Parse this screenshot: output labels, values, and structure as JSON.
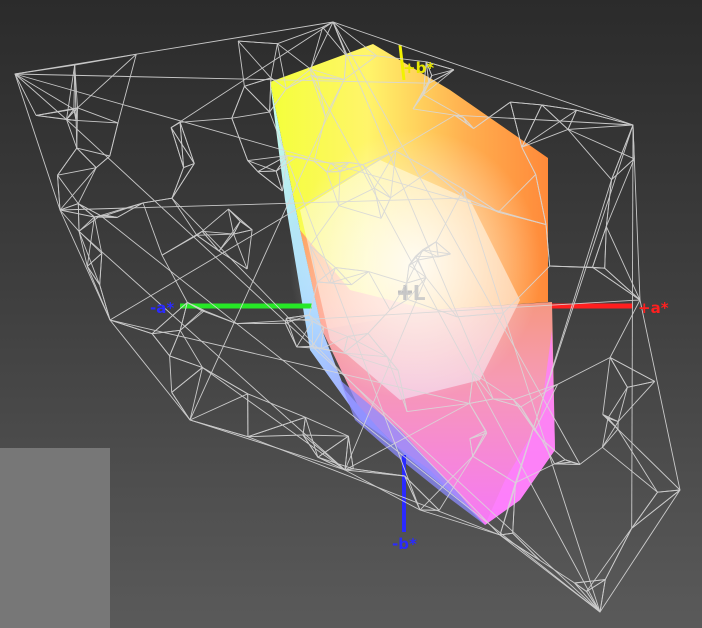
{
  "axes": {
    "plus_b": "+b*",
    "minus_b": "-b*",
    "plus_a": "+a*",
    "minus_a": "-a*",
    "plus_l": "+L"
  },
  "colors": {
    "axis_a_positive": "#ff1f1f",
    "axis_a_negative": "#26e826",
    "axis_b_negative": "#2a2aff",
    "axis_b_positive": "#f2f200",
    "wireframe": "#d8d8d8",
    "panel": "#777777"
  },
  "solid_gamut": {
    "regions": [
      "yellow",
      "orange",
      "white",
      "cyan",
      "blue",
      "magenta"
    ]
  }
}
